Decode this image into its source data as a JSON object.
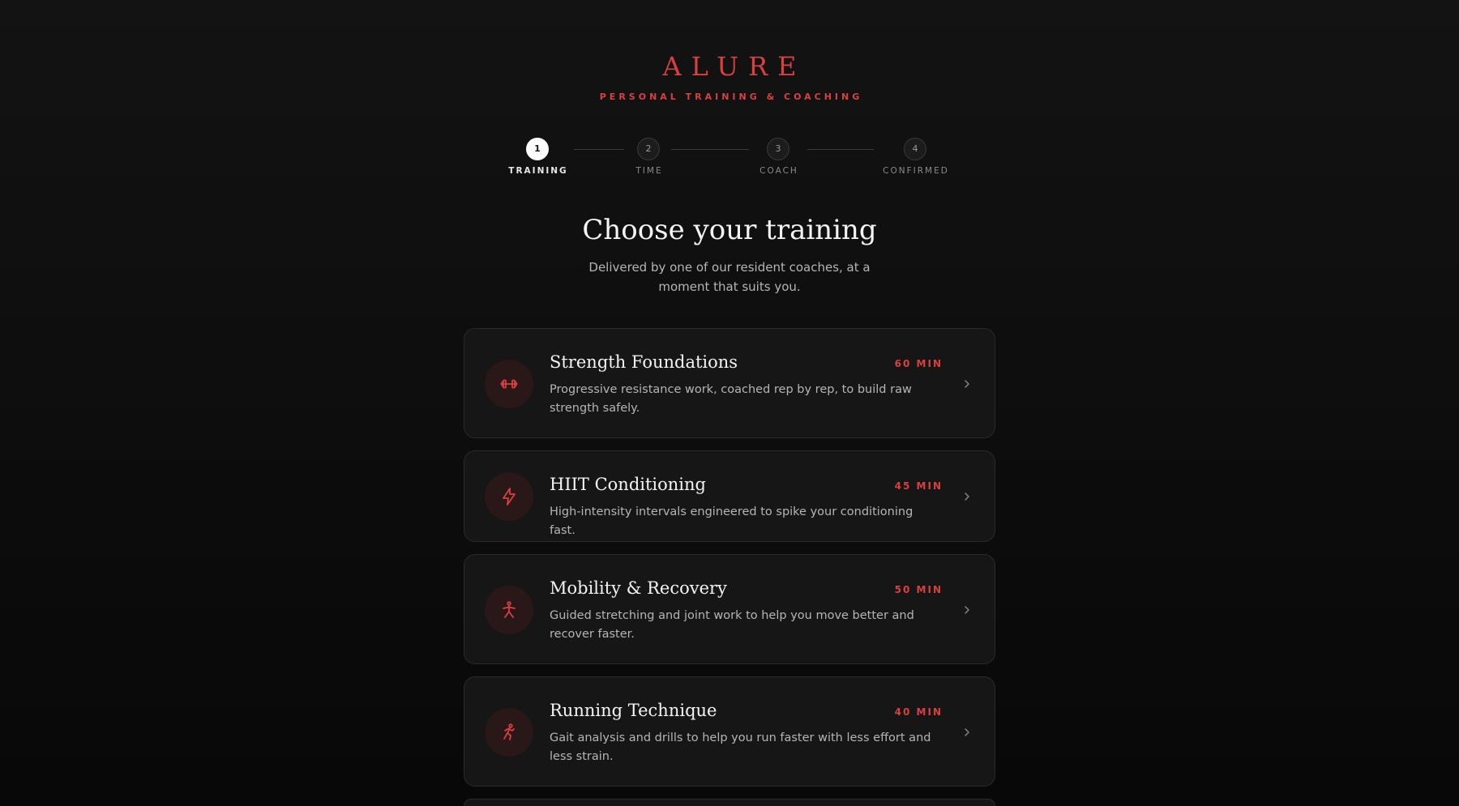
{
  "brand": {
    "name": "ALURE",
    "tagline": "PERSONAL TRAINING & COACHING"
  },
  "colors": {
    "accent": "#d9403e",
    "background": "#0e0e0e",
    "card": "#161616"
  },
  "steps": [
    {
      "number": "1",
      "label": "TRAINING",
      "state": "active"
    },
    {
      "number": "2",
      "label": "TIME",
      "state": "upcoming"
    },
    {
      "number": "3",
      "label": "COACH",
      "state": "upcoming"
    },
    {
      "number": "4",
      "label": "CONFIRMED",
      "state": "upcoming"
    }
  ],
  "main": {
    "title": "Choose your training",
    "subtitle": "Delivered by one of our resident coaches, at a moment that suits you."
  },
  "trainings": [
    {
      "title": "Strength Foundations",
      "duration": "60 MIN",
      "description": "Progressive resistance work, coached rep by rep, to build raw strength safely.",
      "icon": "dumbbell-icon"
    },
    {
      "title": "HIIT Conditioning",
      "duration": "45 MIN",
      "description": "High-intensity intervals engineered to spike your conditioning fast.",
      "icon": "lightning-icon"
    },
    {
      "title": "Mobility & Recovery",
      "duration": "50 MIN",
      "description": "Guided stretching and joint work to help you move better and recover faster.",
      "icon": "stretching-figure-icon"
    },
    {
      "title": "Running Technique",
      "duration": "40 MIN",
      "description": "Gait analysis and drills to help you run faster with less effort and less strain.",
      "icon": "running-figure-icon"
    }
  ]
}
